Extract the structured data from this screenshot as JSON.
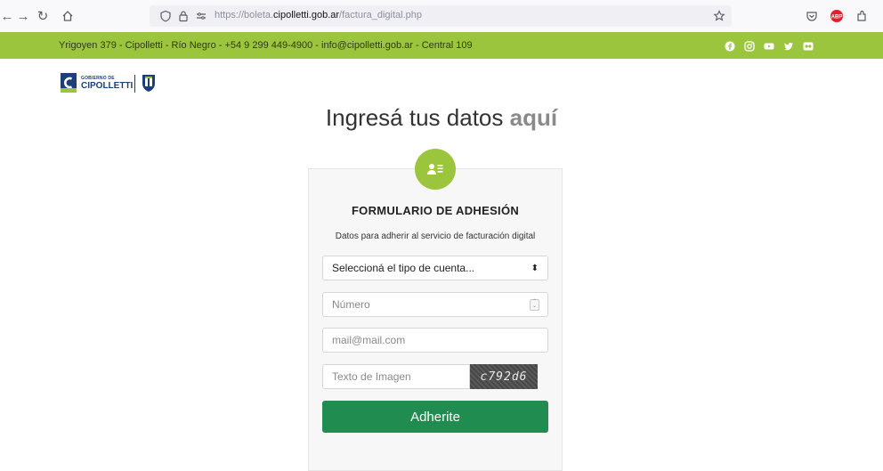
{
  "browser": {
    "url_scheme": "https://boleta.",
    "url_host": "cipolletti.gob.ar",
    "url_path": "/factura_digital.php"
  },
  "topbar": {
    "contact": "Yrigoyen 379 - Cipolletti - Río Negro - +54 9 299 449-4900 - info@cipolletti.gob.ar - Central 109",
    "social_icons": [
      "facebook-icon",
      "instagram-icon",
      "youtube-icon",
      "twitter-icon",
      "flickr-icon"
    ]
  },
  "logo": {
    "badge_letter": "C",
    "line1": "GOBIERNO DE",
    "line2": "CIPOLLETTI"
  },
  "heading": {
    "text": "Ingresá tus datos",
    "accent": "aquí"
  },
  "form": {
    "title": "FORMULARIO DE ADHESIÓN",
    "subtitle": "Datos para adherir al servicio de facturación digital",
    "account_type_select": "Seleccioná el tipo de cuenta...",
    "number_placeholder": "Número",
    "email_placeholder": "mail@mail.com",
    "captcha_placeholder": "Texto de Imagen",
    "captcha_code": "c792d6",
    "submit_label": "Adherite"
  },
  "colors": {
    "brand_green": "#9bc53d",
    "button_green": "#218c4f",
    "logo_blue": "#1c3f7a"
  }
}
